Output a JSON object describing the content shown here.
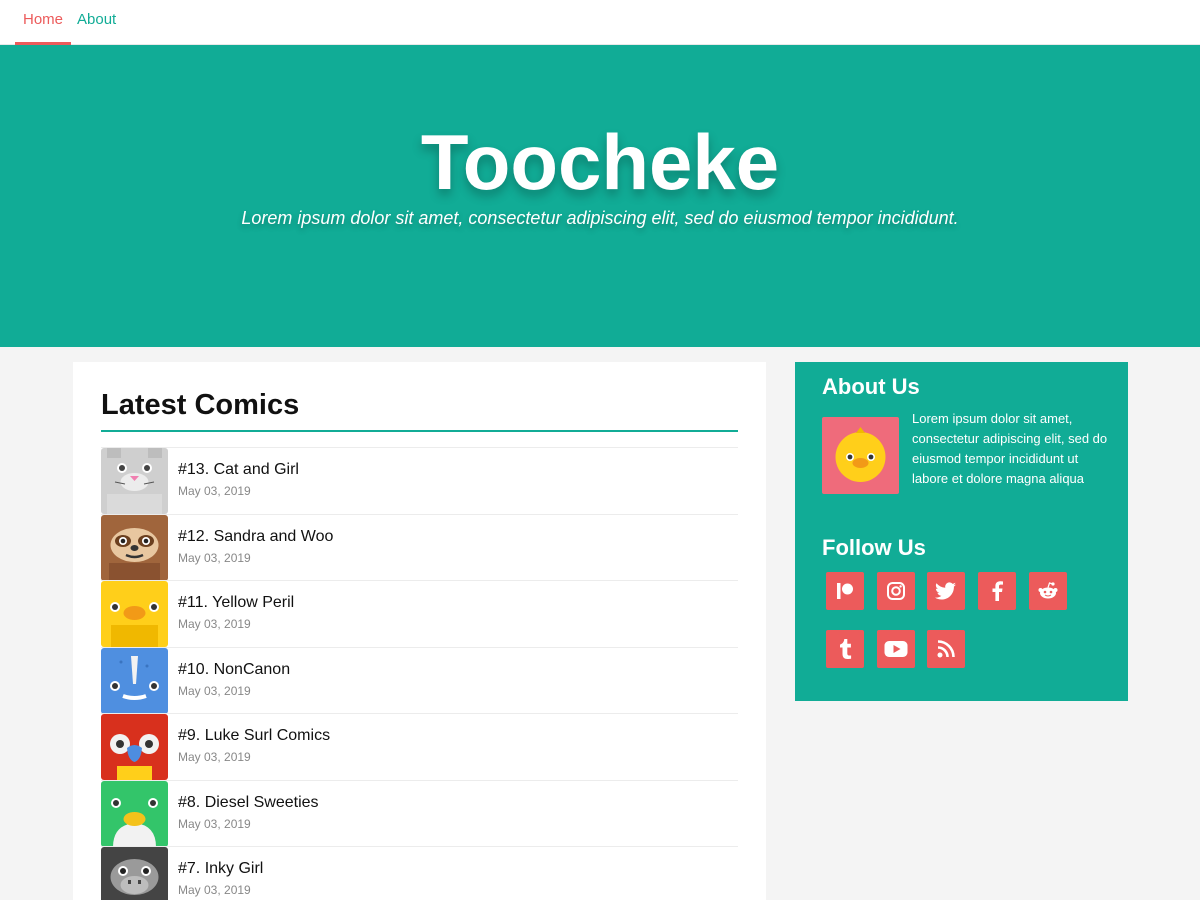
{
  "nav": {
    "home_label": "Home",
    "about_label": "About"
  },
  "hero": {
    "title": "Toocheke",
    "tagline": "Lorem ipsum dolor sit amet, consectetur adipiscing elit, sed do eiusmod tempor incididunt."
  },
  "main": {
    "heading": "Latest Comics",
    "comics": [
      {
        "title": "#13. Cat and Girl",
        "date": "May 03, 2019",
        "icon": "cat-avatar-icon",
        "color": "#cfcfcf"
      },
      {
        "title": "#12. Sandra and Woo",
        "date": "May 03, 2019",
        "icon": "sloth-avatar-icon",
        "color": "#a0653c"
      },
      {
        "title": "#11. Yellow Peril",
        "date": "May 03, 2019",
        "icon": "chick-avatar-icon",
        "color": "#ffcf1a"
      },
      {
        "title": "#10. NonCanon",
        "date": "May 03, 2019",
        "icon": "narwhal-avatar-icon",
        "color": "#4f8fe0"
      },
      {
        "title": "#9. Luke Surl Comics",
        "date": "May 03, 2019",
        "icon": "parrot-avatar-icon",
        "color": "#d8301d"
      },
      {
        "title": "#8. Diesel Sweeties",
        "date": "May 03, 2019",
        "icon": "duck-avatar-icon",
        "color": "#33c56a"
      },
      {
        "title": "#7. Inky Girl",
        "date": "May 03, 2019",
        "icon": "gorilla-avatar-icon",
        "color": "#444444"
      }
    ]
  },
  "sidebar": {
    "about_heading": "About Us",
    "about_text": "Lorem ipsum dolor sit amet, consectetur adipiscing elit, sed do eiusmod tempor incididunt ut labore et dolore magna aliqua",
    "about_icon": "chick-avatar-icon",
    "follow_heading": "Follow Us",
    "social": [
      {
        "icon": "patreon-icon"
      },
      {
        "icon": "instagram-icon"
      },
      {
        "icon": "twitter-icon"
      },
      {
        "icon": "facebook-icon"
      },
      {
        "icon": "reddit-icon"
      },
      {
        "icon": "tumblr-icon"
      },
      {
        "icon": "youtube-icon"
      },
      {
        "icon": "rss-icon"
      }
    ]
  },
  "colors": {
    "accent": "#11ac96",
    "highlight": "#ec5b5b",
    "background": "#f4f4f4"
  }
}
